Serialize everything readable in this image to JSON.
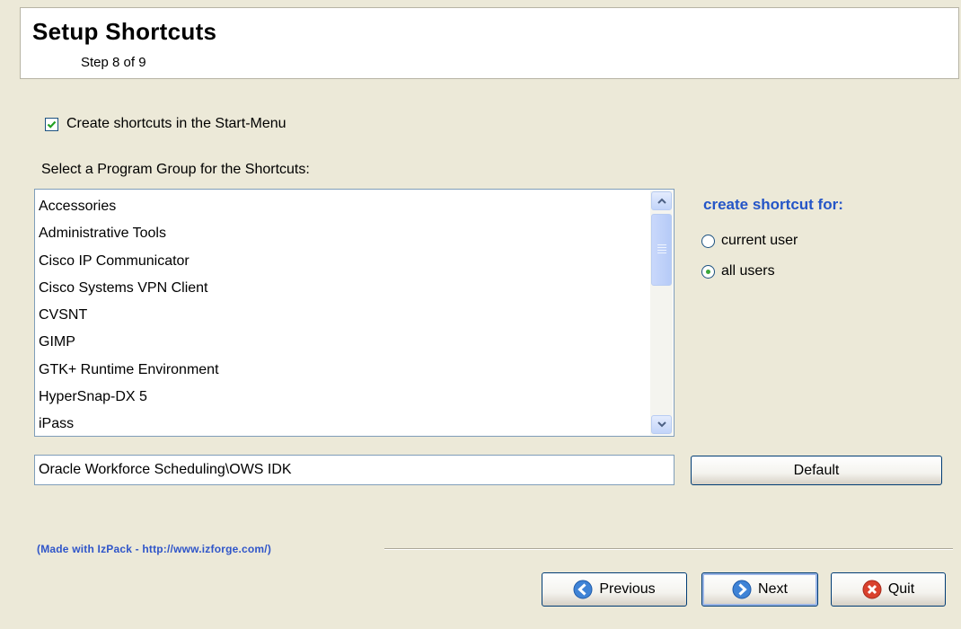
{
  "header": {
    "title": "Setup Shortcuts",
    "step": "Step 8 of 9"
  },
  "start_menu_checkbox": {
    "label": "Create shortcuts in the Start-Menu",
    "checked": true
  },
  "program_group": {
    "label": "Select a Program Group for the Shortcuts:",
    "items": [
      "Accessories",
      "Administrative Tools",
      "Cisco IP Communicator",
      "Cisco Systems VPN Client",
      "CVSNT",
      "GIMP",
      "GTK+ Runtime Environment",
      "HyperSnap-DX 5",
      "iPass"
    ],
    "selected_path": "Oracle Workforce Scheduling\\OWS IDK",
    "default_label": "Default"
  },
  "shortcut_for": {
    "title": "create shortcut for:",
    "options": [
      {
        "label": "current user",
        "selected": false
      },
      {
        "label": "all users",
        "selected": true
      }
    ]
  },
  "footer": {
    "credit": "(Made with IzPack - http://www.izforge.com/)",
    "previous_label": "Previous",
    "next_label": "Next",
    "quit_label": "Quit"
  },
  "colors": {
    "accent_blue": "#2455c7",
    "background": "#ece9d8",
    "quit_red": "#d9412d"
  },
  "icons": [
    "checkmark-icon",
    "scroll-up-arrow-icon",
    "scroll-down-arrow-icon",
    "previous-arrow-icon",
    "next-arrow-icon",
    "quit-x-icon"
  ]
}
